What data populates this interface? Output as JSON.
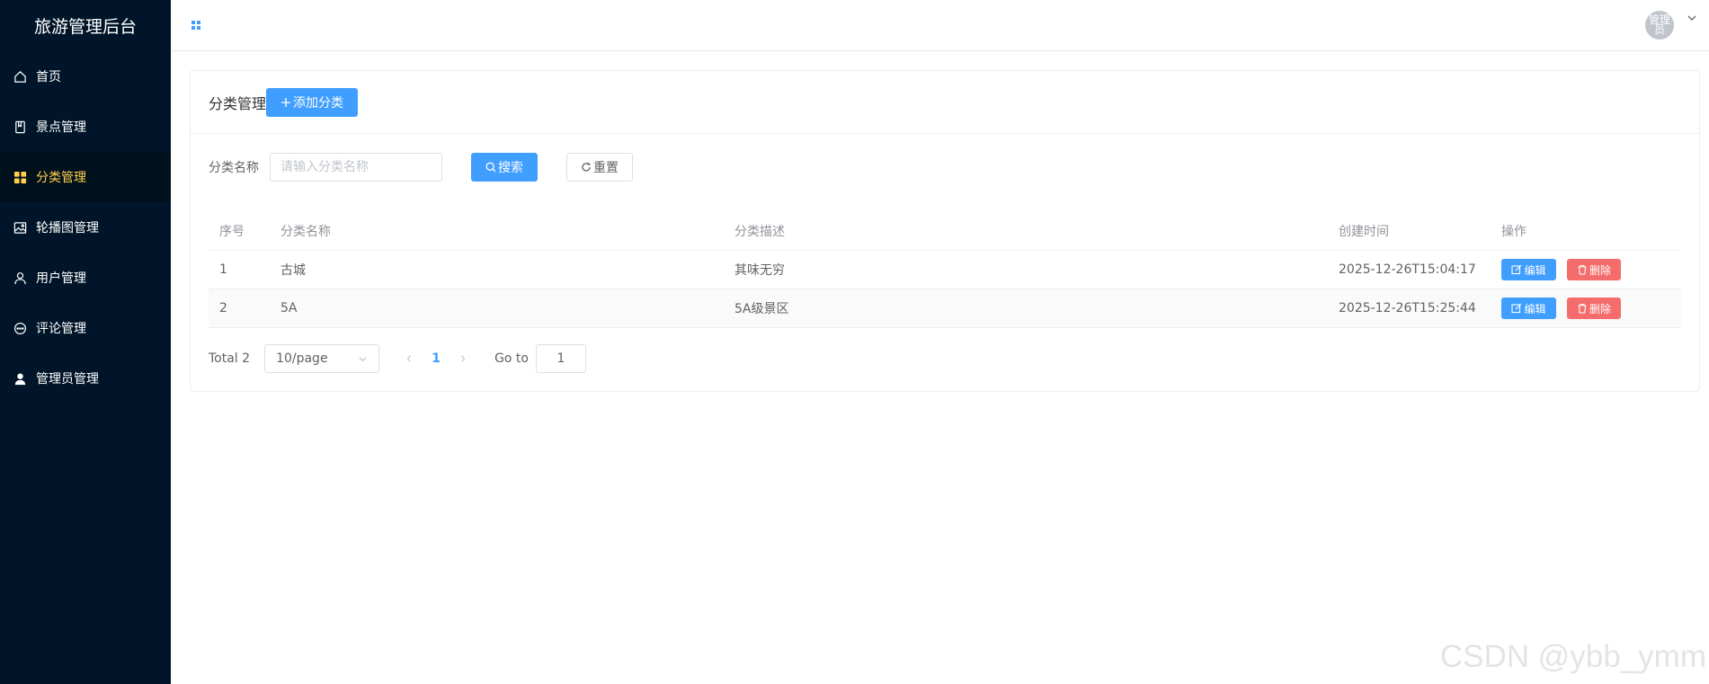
{
  "app": {
    "title": "旅游管理后台"
  },
  "sidebar": {
    "items": [
      {
        "label": "首页",
        "icon": "home-icon",
        "active": false
      },
      {
        "label": "景点管理",
        "icon": "book-icon",
        "active": false
      },
      {
        "label": "分类管理",
        "icon": "grid-icon",
        "active": true
      },
      {
        "label": "轮播图管理",
        "icon": "picture-icon",
        "active": false
      },
      {
        "label": "用户管理",
        "icon": "user-icon",
        "active": false
      },
      {
        "label": "评论管理",
        "icon": "chat-dot-icon",
        "active": false
      },
      {
        "label": "管理员管理",
        "icon": "user-filled-icon",
        "active": false
      }
    ]
  },
  "header": {
    "avatar_text": "管理员"
  },
  "card": {
    "title": "分类管理",
    "add_label": "添加分类"
  },
  "filter": {
    "label": "分类名称",
    "placeholder": "请输入分类名称",
    "search_label": "搜索",
    "reset_label": "重置"
  },
  "table": {
    "headers": [
      "序号",
      "分类名称",
      "分类描述",
      "创建时间",
      "操作"
    ],
    "rows": [
      {
        "index": "1",
        "name": "古城",
        "description": "其味无穷",
        "created": "2025-12-26T15:04:17"
      },
      {
        "index": "2",
        "name": "5A",
        "description": "5A级景区",
        "created": "2025-12-26T15:25:44"
      }
    ],
    "edit_label": "编辑",
    "delete_label": "删除"
  },
  "pagination": {
    "total_text": "Total 2",
    "page_size": "10/page",
    "current_page": "1",
    "goto_label": "Go to",
    "goto_value": "1"
  },
  "watermark": "CSDN @ybb_ymm",
  "colors": {
    "sidebar_bg": "#001529",
    "active_text": "#ffd04b",
    "primary": "#409eff",
    "danger": "#f56c6c"
  }
}
